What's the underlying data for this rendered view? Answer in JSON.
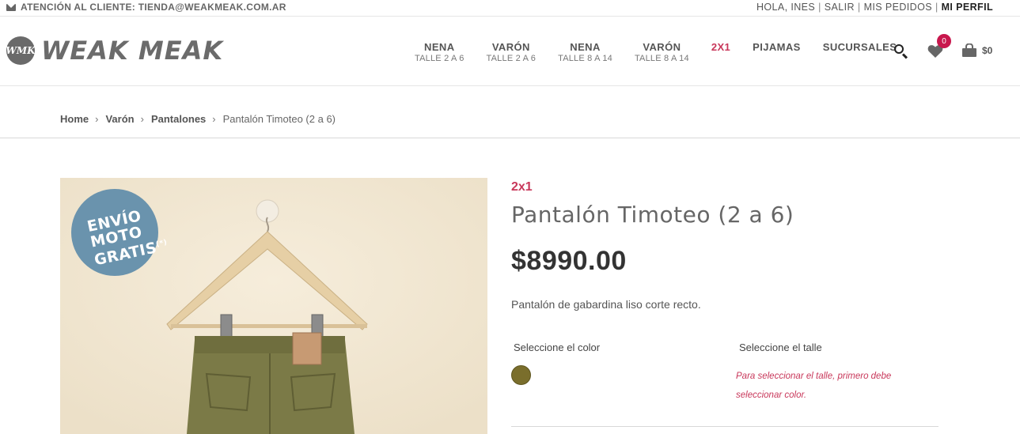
{
  "topbar": {
    "contact_icon": "envelope-icon",
    "contact_text": "ATENCIÓN AL CLIENTE: TIENDA@WEAKMEAK.COM.AR",
    "greeting": "HOLA, INES",
    "sep": "|",
    "logout": "SALIR",
    "orders": "MIS PEDIDOS",
    "profile": "MI PERFIL"
  },
  "header": {
    "logo_mark": "WMK",
    "logo_text": "WEAK MEAK",
    "nav": [
      {
        "main": "NENA",
        "sub": "TALLE 2 A 6"
      },
      {
        "main": "VARÓN",
        "sub": "TALLE 2 A 6"
      },
      {
        "main": "NENA",
        "sub": "TALLE 8 A 14"
      },
      {
        "main": "VARÓN",
        "sub": "TALLE 8 A 14"
      },
      {
        "main": "2X1",
        "sub": ""
      },
      {
        "main": "PIJAMAS",
        "sub": ""
      },
      {
        "main": "SUCURSALES",
        "sub": ""
      }
    ],
    "wishlist_count": "0",
    "cart_total": "$0",
    "accent_color": "#c8375a"
  },
  "breadcrumb": {
    "items": [
      "Home",
      "Varón",
      "Pantalones"
    ],
    "current": "Pantalón Timoteo (2 a 6)",
    "separator": "›"
  },
  "product": {
    "promo_badge": {
      "line1": "ENVÍO",
      "line2": "MOTO",
      "line3": "GRATIS",
      "mark": "(*)"
    },
    "promo_tag": "2x1",
    "title": "Pantalón Timoteo (2 a 6)",
    "price": "$8990.00",
    "description": "Pantalón de gabardina liso corte recto.",
    "color_label": "Seleccione el color",
    "size_label": "Seleccione el talle",
    "size_hint": "Para seleccionar el talle, primero debe seleccionar color.",
    "swatch_color": "#7a6e2c"
  }
}
